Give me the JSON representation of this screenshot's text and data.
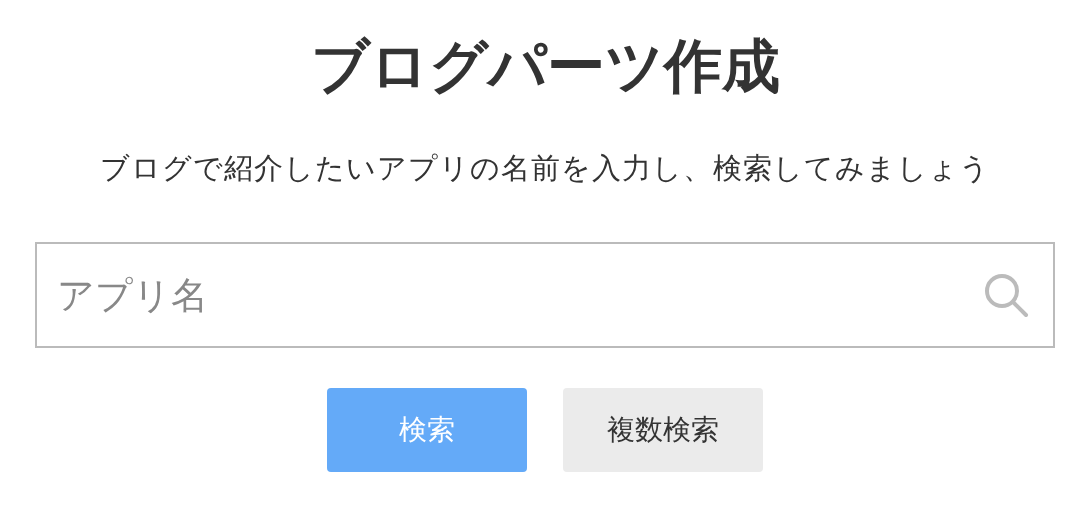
{
  "title": "ブログパーツ作成",
  "subtitle": "ブログで紹介したいアプリの名前を入力し、検索してみましょう",
  "search": {
    "placeholder": "アプリ名"
  },
  "buttons": [
    {
      "label": "検索",
      "kind": "primary"
    },
    {
      "label": "複数検索",
      "kind": "secondary"
    }
  ]
}
